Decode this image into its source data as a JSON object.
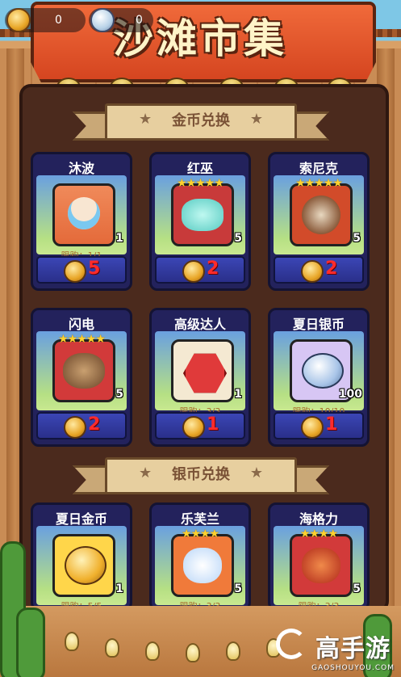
{
  "currency": {
    "gold_value": "0",
    "silver_value": "0",
    "gold_icon": "gold-shell-icon",
    "silver_icon": "silver-shell-icon"
  },
  "title": "沙滩市集",
  "sections": {
    "gold": {
      "label": "金币兑换"
    },
    "silver": {
      "label": "银币兑换"
    }
  },
  "gold_shop": [
    {
      "name": "沐波",
      "qty": "1",
      "limit": "限购：1/1",
      "price": "5",
      "stars": "",
      "icon": "mubo-avatar"
    },
    {
      "name": "红巫",
      "qty": "5",
      "limit": "",
      "price": "2",
      "stars": "★★★★★",
      "icon": "hongwu-avatar"
    },
    {
      "name": "索尼克",
      "qty": "5",
      "limit": "",
      "price": "2",
      "stars": "★★★★★",
      "icon": "suonike-avatar"
    },
    {
      "name": "闪电",
      "qty": "5",
      "limit": "",
      "price": "2",
      "stars": "★★★★★",
      "icon": "shandian-avatar"
    },
    {
      "name": "高级达人",
      "qty": "1",
      "limit": "限购：3/3",
      "price": "1",
      "stars": "",
      "icon": "gaoji-badge"
    },
    {
      "name": "夏日银币",
      "qty": "100",
      "limit": "限购：10/10",
      "price": "1",
      "stars": "",
      "icon": "silver-shell"
    }
  ],
  "silver_shop": [
    {
      "name": "夏日金币",
      "qty": "1",
      "limit": "限购：5/5",
      "stars": "",
      "icon": "gold-shell"
    },
    {
      "name": "乐芙兰",
      "qty": "5",
      "limit": "限购：3/3",
      "stars": "★★★★",
      "icon": "lefulan-avatar"
    },
    {
      "name": "海格力",
      "qty": "5",
      "limit": "限购：3/3",
      "stars": "★★★★",
      "icon": "haigeli-avatar"
    }
  ],
  "watermark": {
    "big": "高手游",
    "small": "GAOSHOUYOU.COM"
  },
  "colors": {
    "price": "#ff2b2b",
    "banner": "#e4552a",
    "board": "#4b2a1d"
  }
}
